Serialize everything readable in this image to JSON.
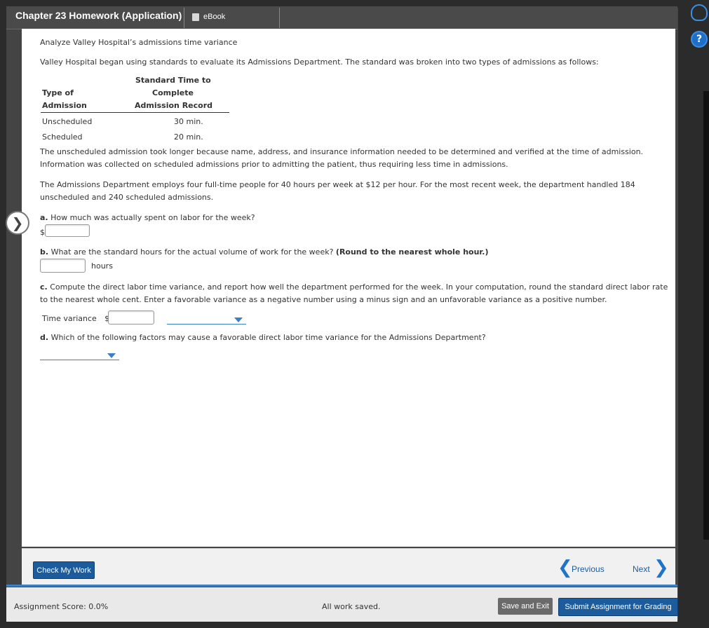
{
  "header": {
    "title": "Chapter 23 Homework (Application)",
    "ebook_label": "eBook"
  },
  "problem": {
    "heading": "Analyze Valley Hospital’s admissions time variance",
    "intro": "Valley Hospital began using standards to evaluate its Admissions Department. The standard was broken into two types of admissions as follows:",
    "table": {
      "col1_header_line1": "Type of",
      "col1_header_line2": "Admission",
      "col2_header_line1": "Standard Time to",
      "col2_header_line2": "Complete",
      "col2_header_line3": "Admission Record",
      "rows": [
        {
          "type": "Unscheduled",
          "time": "30 min."
        },
        {
          "type": "Scheduled",
          "time": "20 min."
        }
      ]
    },
    "para1": "The unscheduled admission took longer because name, address, and insurance information needed to be determined and verified at the time of admission. Information was collected on scheduled admissions prior to admitting the patient, thus requiring less time in admissions.",
    "para2": "The Admissions Department employs four full-time people for 40 hours per week at $12 per hour. For the most recent week, the department handled 184 unscheduled and 240 scheduled admissions."
  },
  "questions": {
    "a": {
      "label": "a.",
      "text": "How much was actually spent on labor for the week?",
      "currency": "$",
      "value": ""
    },
    "b": {
      "label": "b.",
      "text": "What are the standard hours for the actual volume of work for the week?",
      "emphasis": "(Round to the nearest whole hour.)",
      "value": "",
      "unit": "hours"
    },
    "c": {
      "label": "c.",
      "text": "Compute the direct labor time variance, and report how well the department performed for the week. In your computation, round the standard direct labor rate to the nearest whole cent. Enter a favorable variance as a negative number using a minus sign and an unfavorable variance as a positive number.",
      "row_label": "Time variance",
      "currency": "$",
      "value": "",
      "select_value": ""
    },
    "d": {
      "label": "d.",
      "text": "Which of the following factors may cause a favorable direct labor time variance for the Admissions Department?",
      "select_value": ""
    }
  },
  "nav": {
    "check_label": "Check My Work",
    "previous_label": "Previous",
    "next_label": "Next"
  },
  "footer": {
    "score": "Assignment Score: 0.0%",
    "saved": "All work saved.",
    "save_exit": "Save and Exit",
    "submit": "Submit Assignment for Grading"
  },
  "colors": {
    "accent": "#1c5c9c",
    "link": "#3b7fc4"
  }
}
